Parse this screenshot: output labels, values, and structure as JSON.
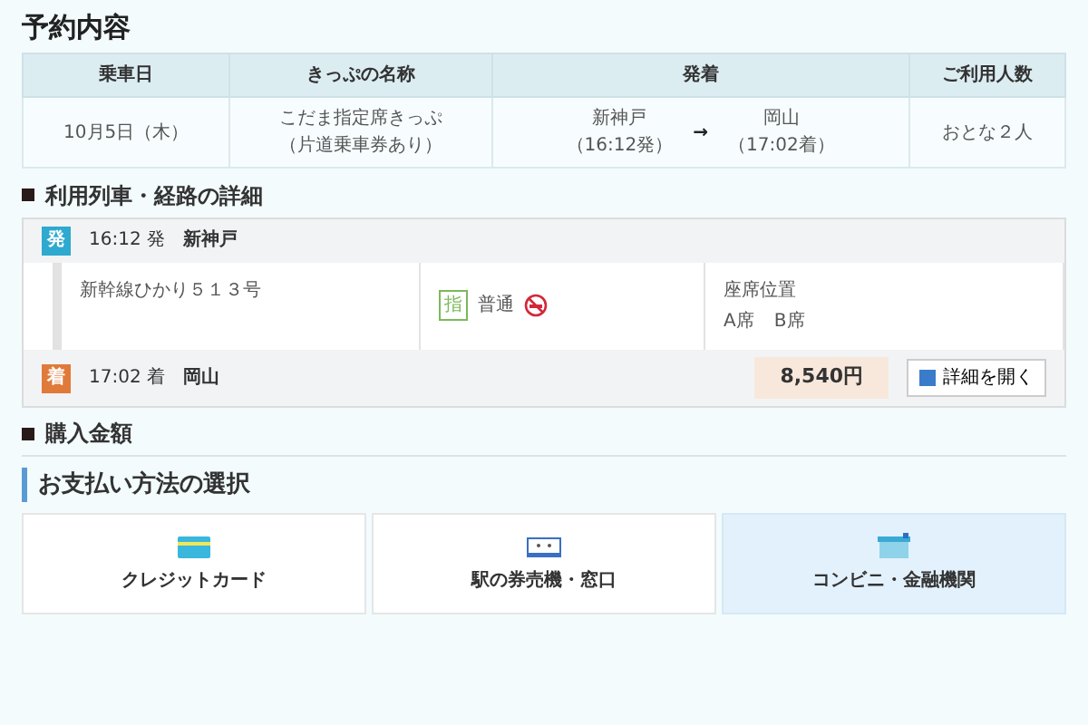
{
  "reservation": {
    "title": "予約内容",
    "columns": [
      "乗車日",
      "きっぷの名称",
      "発着",
      "ご利用人数"
    ],
    "row": {
      "date": "10月5日（木）",
      "ticket_name": "こだま指定席きっぷ",
      "ticket_note": "（片道乗車券あり）",
      "from_station": "新神戸",
      "from_time": "（16:12発）",
      "arrow": "→",
      "to_station": "岡山",
      "to_time": "（17:02着）",
      "passengers": "おとな２人"
    }
  },
  "route": {
    "title": "利用列車・経路の詳細",
    "departure": {
      "badge": "発",
      "time": "16:12 発",
      "station": "新神戸"
    },
    "train": {
      "name": "新幹線ひかり５１３号",
      "car_badge": "指",
      "car_type": "普通",
      "no_smoking": true,
      "seat_label": "座席位置",
      "seats": [
        "A席",
        "B席"
      ]
    },
    "arrival": {
      "badge": "着",
      "time": "17:02 着",
      "station": "岡山"
    },
    "price": "8,540円",
    "details_button": "詳細を開く"
  },
  "purchase": {
    "title": "購入金額"
  },
  "payment": {
    "title": "お支払い方法の選択",
    "options": [
      {
        "kind": "card",
        "label": "クレジットカード",
        "selected": false
      },
      {
        "kind": "machine",
        "label": "駅の券売機・窓口",
        "selected": false
      },
      {
        "kind": "store",
        "label": "コンビニ・金融機関",
        "selected": true
      }
    ]
  }
}
